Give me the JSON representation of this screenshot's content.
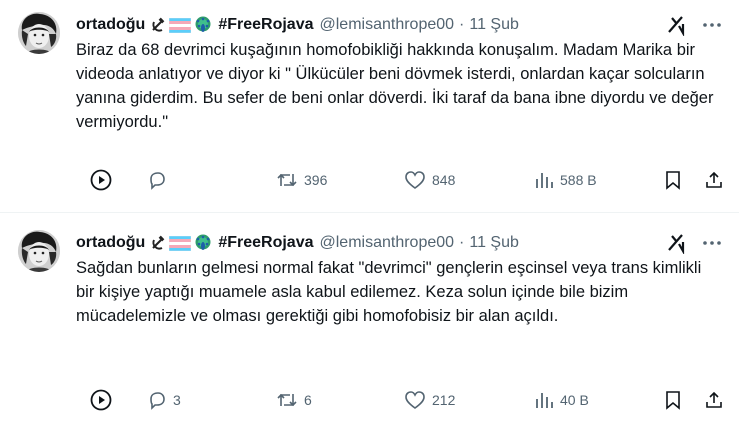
{
  "tweets": [
    {
      "display_name": "ortadoğu",
      "hashtag": "#FreeRojava",
      "handle": "@lemisanthrope00",
      "date": "11 Şub",
      "text": "Biraz da 68 devrimci kuşağının homofobikliği hakkında konuşalım. Madam Marika bir videoda anlatıyor ve diyor ki \" Ülkücüler beni dövmek isterdi, onlardan kaçar solcuların yanına giderdim. Bu sefer de beni onlar döverdi. İki taraf da bana ibne diyordu ve değer vermiyordu.\"",
      "reply_count": "",
      "retweet_count": "396",
      "like_count": "848",
      "view_count": "588 B"
    },
    {
      "display_name": "ortadoğu",
      "hashtag": "#FreeRojava",
      "handle": "@lemisanthrope00",
      "date": "11 Şub",
      "text": "Sağdan bunların gelmesi normal fakat \"devrimci\" gençlerin eşcinsel veya trans kimlikli bir kişiye yaptığı muamele asla kabul edilemez. Keza solun içinde bile bizim mücadelemizle ve olması gerektiği gibi homofobisiz bir alan açıldı.",
      "reply_count": "3",
      "retweet_count": "6",
      "like_count": "212",
      "view_count": "40 B"
    }
  ],
  "icons": {
    "name_emoji": [
      "hammer-sickle-icon",
      "trans-flag-icon",
      "peacock-icon"
    ],
    "actions": [
      "play-icon",
      "reply-icon",
      "retweet-icon",
      "like-icon",
      "views-icon",
      "bookmark-icon",
      "share-icon"
    ],
    "header": [
      "grok-icon",
      "more-icon"
    ]
  },
  "colors": {
    "text": "#0f1419",
    "secondary": "#536471",
    "border": "#eff3f4",
    "trans_blue": "#5bcefa",
    "trans_pink": "#f5a9b8"
  }
}
